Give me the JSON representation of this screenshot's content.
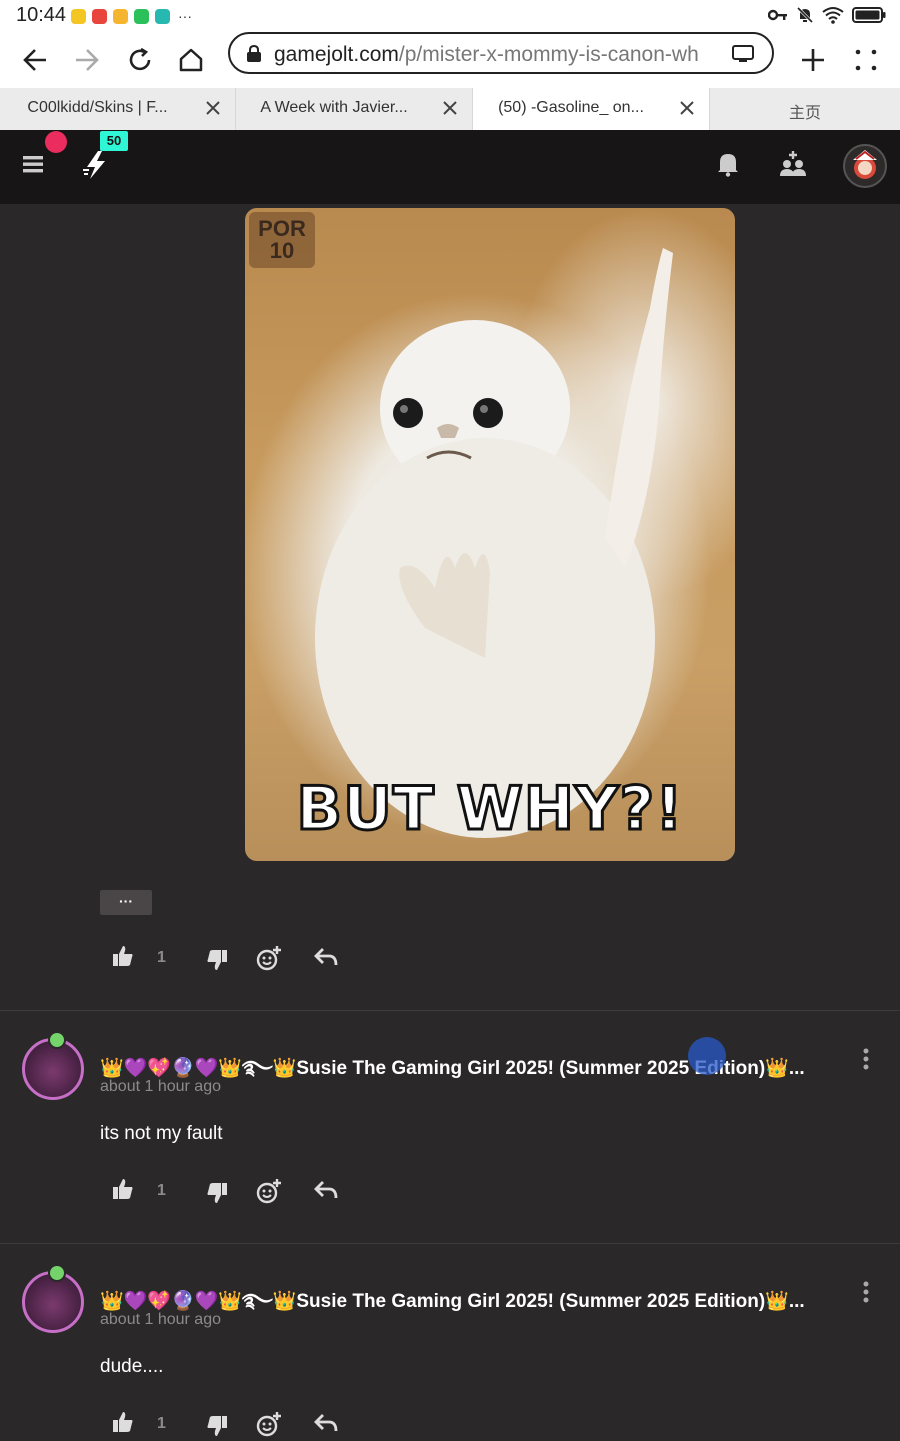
{
  "status_bar": {
    "time": "10:44",
    "more": "···"
  },
  "browser": {
    "url_host": "gamejolt.com",
    "url_path": "/p/mister-x-mommy-is-canon-wh",
    "tabs": [
      {
        "label": "C00lkidd/Skins | F..."
      },
      {
        "label": "A Week with Javier..."
      },
      {
        "label": "(50) -Gasoline_ on..."
      },
      {
        "label": "主页"
      }
    ]
  },
  "site": {
    "notification_count": "50"
  },
  "post": {
    "meme_watermark": "POR 10",
    "meme_caption": "BUT WHY?!",
    "more_label": "···",
    "like_count": "1"
  },
  "comments": [
    {
      "author": "👑💜💖🔮💜👑࿐👑Susie The Gaming Girl 2025! (Summer 2025 Edition)👑...",
      "time": "about 1 hour ago",
      "body": "its not my fault",
      "like_count": "1"
    },
    {
      "author": "👑💜💖🔮💜👑࿐👑Susie The Gaming Girl 2025! (Summer 2025 Edition)👑...",
      "time": "about 1 hour ago",
      "body": "dude....",
      "like_count": "1"
    }
  ],
  "colors": {
    "accent": "#2ff7d6",
    "notification": "#ea2c5e",
    "header": "#171515",
    "page": "#2b2829"
  }
}
